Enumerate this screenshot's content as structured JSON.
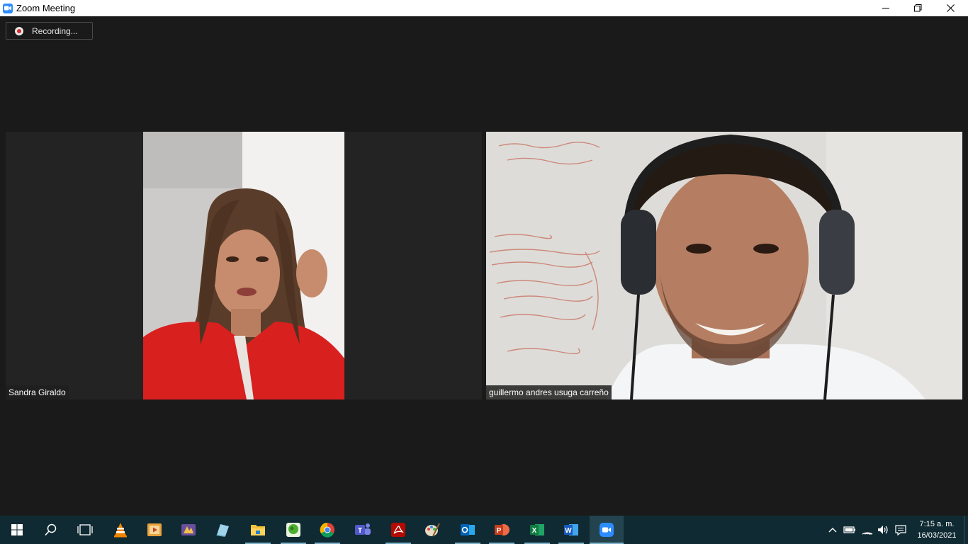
{
  "window": {
    "title": "Zoom Meeting",
    "icon": "zoom-camera-icon",
    "controls": [
      "minimize-icon",
      "restore-icon",
      "close-icon"
    ]
  },
  "recording": {
    "label": "Recording...",
    "icon": "record-dot-icon",
    "dot_color": "#d92b2b"
  },
  "participants": [
    {
      "name": "Sandra Giraldo"
    },
    {
      "name": "guillermo andres usuga carreño"
    }
  ],
  "taskbar": {
    "background": "#0f2a33",
    "apps": [
      "windows-start-icon",
      "search-icon",
      "task-view-icon",
      "vlc-icon",
      "media-player-icon",
      "app-icon",
      "notes-icon",
      "file-explorer-icon",
      "green-app-icon",
      "chrome-icon",
      "teams-icon",
      "acrobat-icon",
      "paint-icon",
      "outlook-icon",
      "powerpoint-icon",
      "excel-icon",
      "word-icon",
      "zoom-icon"
    ],
    "time": "7:15 a. m.",
    "date": "16/03/2021"
  }
}
